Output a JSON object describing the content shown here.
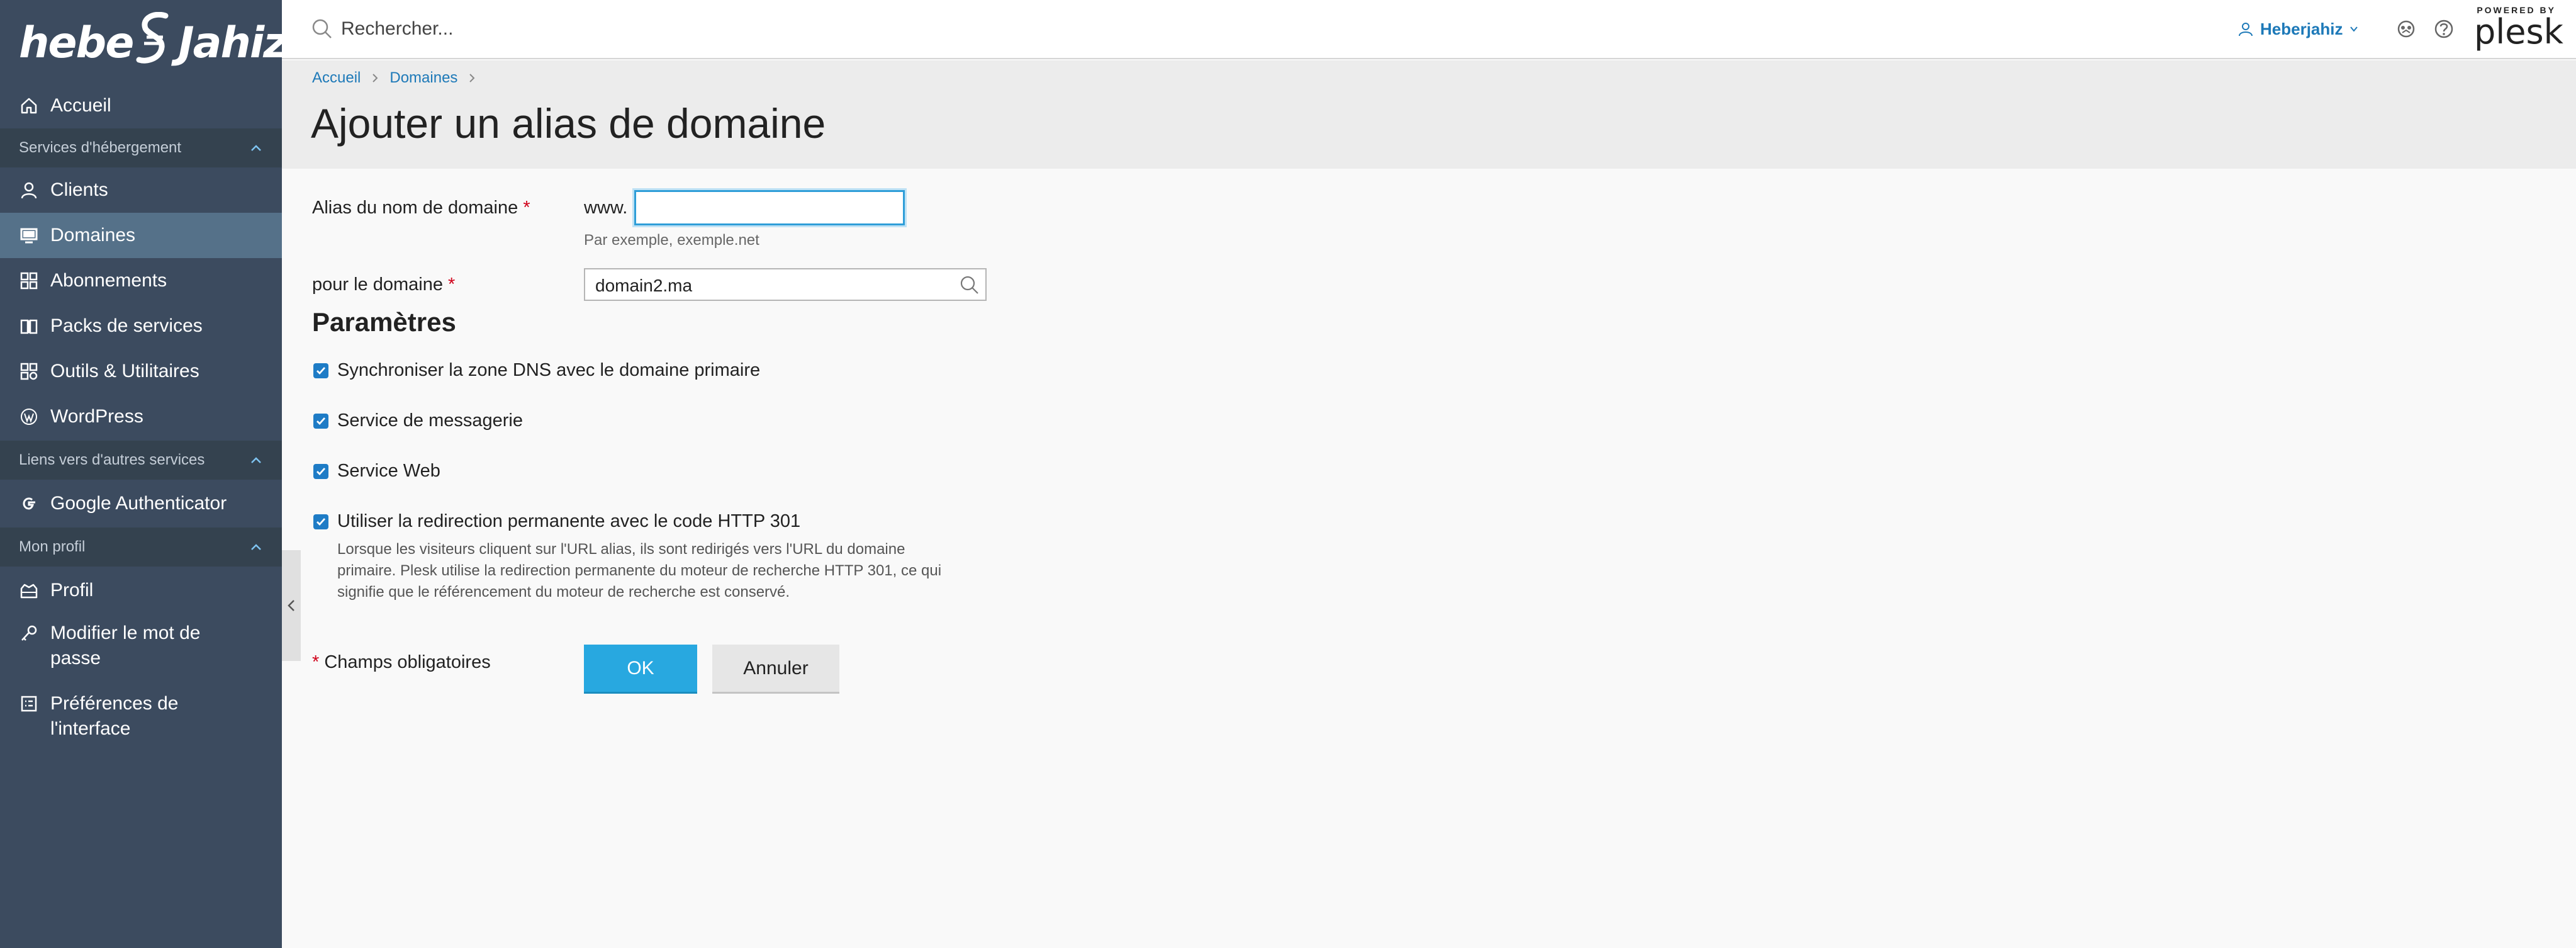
{
  "brand": {
    "logo_text_left": "hebe",
    "logo_text_right": "Jahiz"
  },
  "sidebar": {
    "items": [
      {
        "label": "Accueil",
        "icon": "home-icon"
      },
      {
        "label": "Clients",
        "icon": "user-icon"
      },
      {
        "label": "Domaines",
        "icon": "monitor-icon",
        "active": true
      },
      {
        "label": "Abonnements",
        "icon": "grid-icon"
      },
      {
        "label": "Packs de services",
        "icon": "book-icon"
      },
      {
        "label": "Outils & Utilitaires",
        "icon": "tools-icon"
      },
      {
        "label": "WordPress",
        "icon": "wordpress-icon"
      },
      {
        "label": "Google Authenticator",
        "icon": "google-icon"
      },
      {
        "label": "Profil",
        "icon": "profile-icon"
      },
      {
        "label": "Modifier le mot de passe",
        "icon": "key-icon"
      },
      {
        "label": "Préférences de l'interface",
        "icon": "preferences-icon"
      }
    ],
    "sections": [
      {
        "label": "Services d'hébergement"
      },
      {
        "label": "Liens vers d'autres services"
      },
      {
        "label": "Mon profil"
      }
    ]
  },
  "topbar": {
    "search_placeholder": "Rechercher...",
    "user_name": "Heberjahiz",
    "powered_by": "POWERED BY",
    "plesk": "plesk"
  },
  "breadcrumb": {
    "items": [
      "Accueil",
      "Domaines"
    ]
  },
  "page": {
    "title": "Ajouter un alias de domaine"
  },
  "form": {
    "alias_label": "Alias du nom de domaine",
    "www_prefix": "www.",
    "alias_value": "",
    "alias_hint": "Par exemple, exemple.net",
    "domain_label": "pour le domaine",
    "domain_value": "domain2.ma",
    "required_mark": "*",
    "params_title": "Paramètres",
    "checkboxes": [
      {
        "label": "Synchroniser la zone DNS avec le domaine primaire",
        "checked": true
      },
      {
        "label": "Service de messagerie",
        "checked": true
      },
      {
        "label": "Service Web",
        "checked": true
      },
      {
        "label": "Utiliser la redirection permanente avec le code HTTP 301",
        "checked": true
      }
    ],
    "redirect_description": "Lorsque les visiteurs cliquent sur l'URL alias, ils sont redirigés vers l'URL du domaine primaire. Plesk utilise la redirection permanente du moteur de recherche HTTP 301, ce qui signifie que le référencement du moteur de recherche est conservé.",
    "required_note": "Champs obligatoires",
    "ok_label": "OK",
    "cancel_label": "Annuler"
  },
  "colors": {
    "sidebar_bg": "#3c4b5f",
    "sidebar_active": "#557189",
    "accent": "#28a8e0",
    "link": "#1d79b8",
    "required": "#d0021b"
  }
}
